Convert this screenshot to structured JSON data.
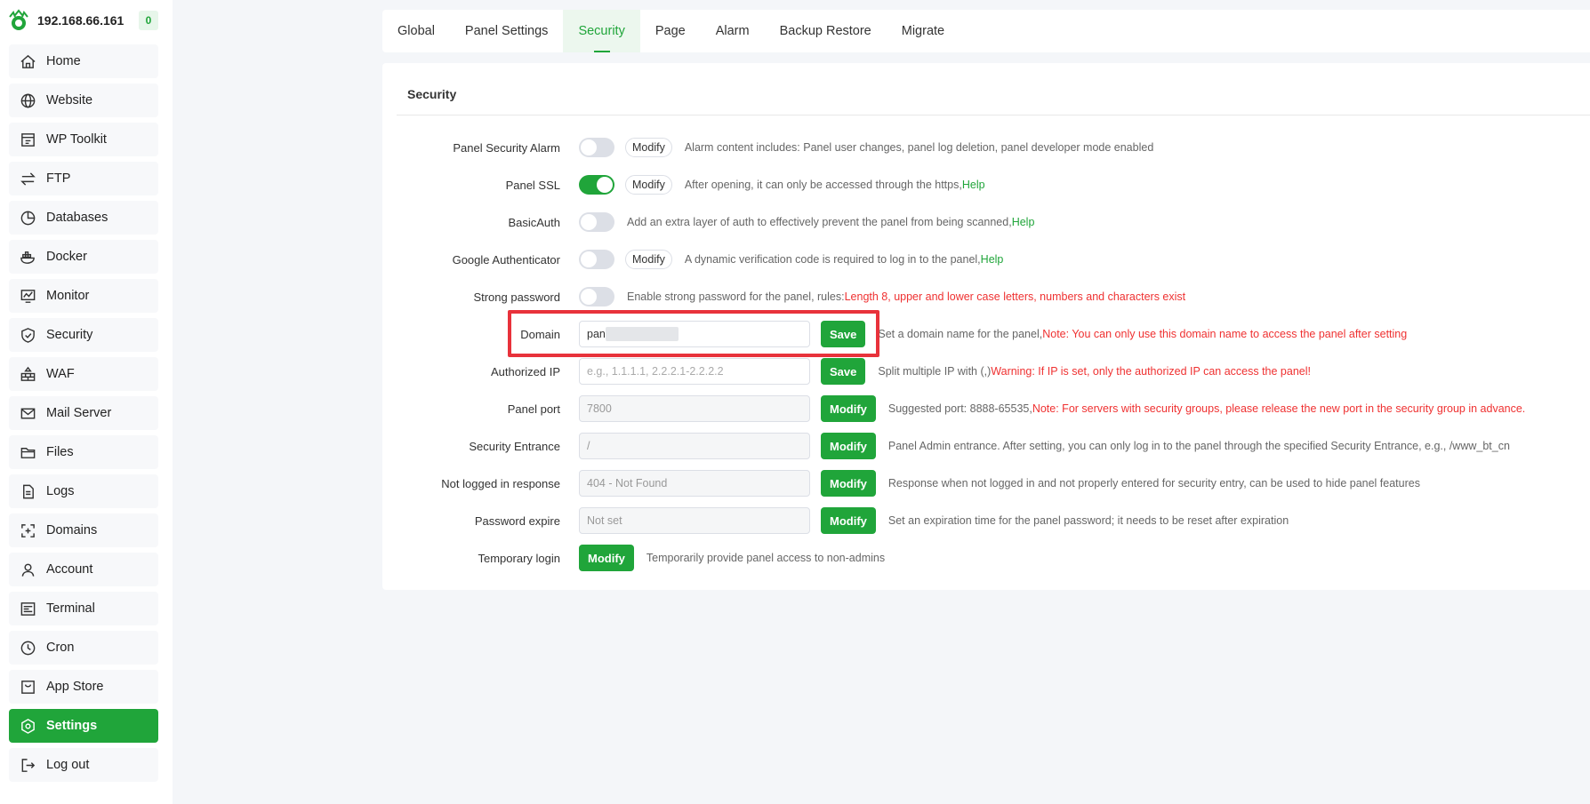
{
  "brand": {
    "ip": "192.168.66.161",
    "badge": "0"
  },
  "sidebar": {
    "items": [
      {
        "label": "Home",
        "icon": "home-icon"
      },
      {
        "label": "Website",
        "icon": "globe-icon"
      },
      {
        "label": "WP Toolkit",
        "icon": "toolkit-icon"
      },
      {
        "label": "FTP",
        "icon": "transfer-icon"
      },
      {
        "label": "Databases",
        "icon": "database-icon"
      },
      {
        "label": "Docker",
        "icon": "docker-icon"
      },
      {
        "label": "Monitor",
        "icon": "monitor-icon"
      },
      {
        "label": "Security",
        "icon": "shield-icon"
      },
      {
        "label": "WAF",
        "icon": "firewall-icon"
      },
      {
        "label": "Mail Server",
        "icon": "mail-icon"
      },
      {
        "label": "Files",
        "icon": "folder-icon"
      },
      {
        "label": "Logs",
        "icon": "log-icon"
      },
      {
        "label": "Domains",
        "icon": "domain-icon"
      },
      {
        "label": "Account",
        "icon": "user-icon"
      },
      {
        "label": "Terminal",
        "icon": "terminal-icon"
      },
      {
        "label": "Cron",
        "icon": "clock-icon"
      },
      {
        "label": "App Store",
        "icon": "store-icon"
      },
      {
        "label": "Settings",
        "icon": "settings-icon"
      },
      {
        "label": "Log out",
        "icon": "logout-icon"
      }
    ]
  },
  "tabs": [
    {
      "label": "Global"
    },
    {
      "label": "Panel Settings"
    },
    {
      "label": "Security"
    },
    {
      "label": "Page"
    },
    {
      "label": "Alarm"
    },
    {
      "label": "Backup Restore"
    },
    {
      "label": "Migrate"
    }
  ],
  "panel": {
    "title": "Security",
    "rows": {
      "security_alarm": {
        "label": "Panel Security Alarm",
        "button": "Modify",
        "desc": "Alarm content includes: Panel user changes, panel log deletion, panel developer mode enabled"
      },
      "ssl": {
        "label": "Panel SSL",
        "button": "Modify",
        "desc": "After opening, it can only be accessed through the https,",
        "link": "Help"
      },
      "basic_auth": {
        "label": "BasicAuth",
        "desc": "Add an extra layer of auth to effectively prevent the panel from being scanned,",
        "link": "Help"
      },
      "google_auth": {
        "label": "Google Authenticator",
        "button": "Modify",
        "desc": "A dynamic verification code is required to log in to the panel,",
        "link": "Help"
      },
      "strong_password": {
        "label": "Strong password",
        "desc": "Enable strong password for the panel, rules:",
        "warn": "Length 8, upper and lower case letters, numbers and characters exist"
      },
      "domain": {
        "label": "Domain",
        "value": "pan",
        "button": "Save",
        "desc": "Set a domain name for the panel,",
        "warn": "Note: You can only use this domain name to access the panel after setting"
      },
      "authorized_ip": {
        "label": "Authorized IP",
        "placeholder": "e.g., 1.1.1.1, 2.2.2.1-2.2.2.2",
        "button": "Save",
        "desc": "Split multiple IP with (,)",
        "warn": "Warning: If IP is set, only the authorized IP can access the panel!"
      },
      "panel_port": {
        "label": "Panel port",
        "placeholder": "7800",
        "button": "Modify",
        "desc": "Suggested port: 8888-65535,",
        "warn": "Note: For servers with security groups, please release the new port in the security group in advance."
      },
      "security_entrance": {
        "label": "Security Entrance",
        "placeholder": "/",
        "button": "Modify",
        "desc": "Panel Admin entrance. After setting, you can only log in to the panel through the specified Security Entrance, e.g., /www_bt_cn"
      },
      "not_logged": {
        "label": "Not logged in response",
        "placeholder": "404 - Not Found",
        "button": "Modify",
        "desc": "Response when not logged in and not properly entered for security entry, can be used to hide panel features"
      },
      "password_expire": {
        "label": "Password expire",
        "placeholder": "Not set",
        "button": "Modify",
        "desc": "Set an expiration time for the panel password; it needs to be reset after expiration"
      },
      "temporary_login": {
        "label": "Temporary login",
        "button": "Modify",
        "desc": "Temporarily provide panel access to non-admins"
      }
    }
  },
  "colors": {
    "accent": "#20a53a",
    "warn": "#ef3131",
    "highlight": "#e8323b"
  }
}
